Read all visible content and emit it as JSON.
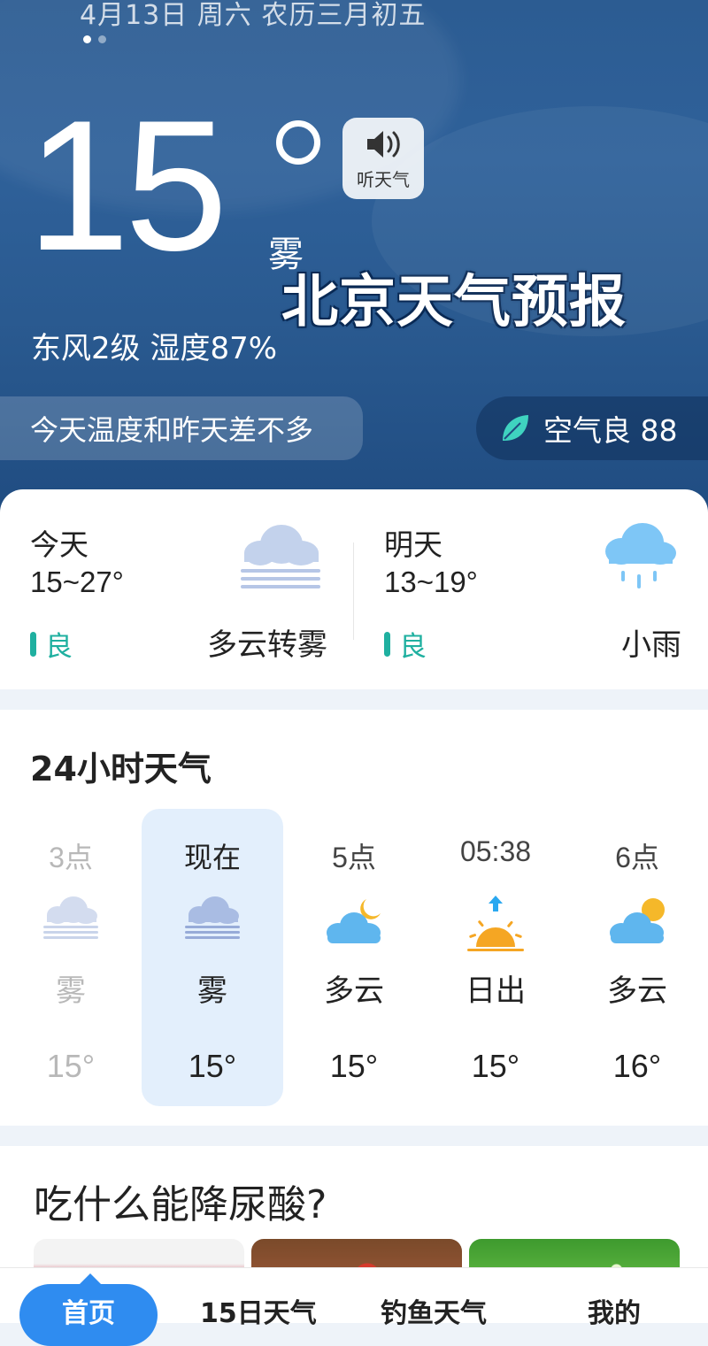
{
  "header": {
    "date": "4月13日 周六 农历三月初五",
    "temperature": "15",
    "condition": "雾",
    "overlay_title": "北京天气预报",
    "listen_label": "听天气",
    "wind_humidity": "东风2级 湿度87%",
    "tip": "今天温度和昨天差不多",
    "aqi": "空气良 88"
  },
  "days": [
    {
      "label": "今天",
      "range": "15~27°",
      "quality": "良",
      "desc": "多云转雾",
      "icon": "fog-cloud-icon"
    },
    {
      "label": "明天",
      "range": "13~19°",
      "quality": "良",
      "desc": "小雨",
      "icon": "rain-cloud-icon"
    }
  ],
  "hourly": {
    "title": "24小时天气",
    "items": [
      {
        "time": "3点",
        "weather": "雾",
        "temp": "15°",
        "icon": "fog-icon"
      },
      {
        "time": "现在",
        "weather": "雾",
        "temp": "15°",
        "icon": "fog-icon"
      },
      {
        "time": "5点",
        "weather": "多云",
        "temp": "15°",
        "icon": "cloud-moon-icon"
      },
      {
        "time": "05:38",
        "weather": "日出",
        "temp": "15°",
        "icon": "sunrise-icon"
      },
      {
        "time": "6点",
        "weather": "多云",
        "temp": "16°",
        "icon": "cloud-sun-icon"
      }
    ]
  },
  "article": {
    "title": "吃什么能降尿酸?"
  },
  "nav": {
    "home": "首页",
    "forecast15": "15日天气",
    "fishing": "钓鱼天气",
    "mine": "我的"
  }
}
